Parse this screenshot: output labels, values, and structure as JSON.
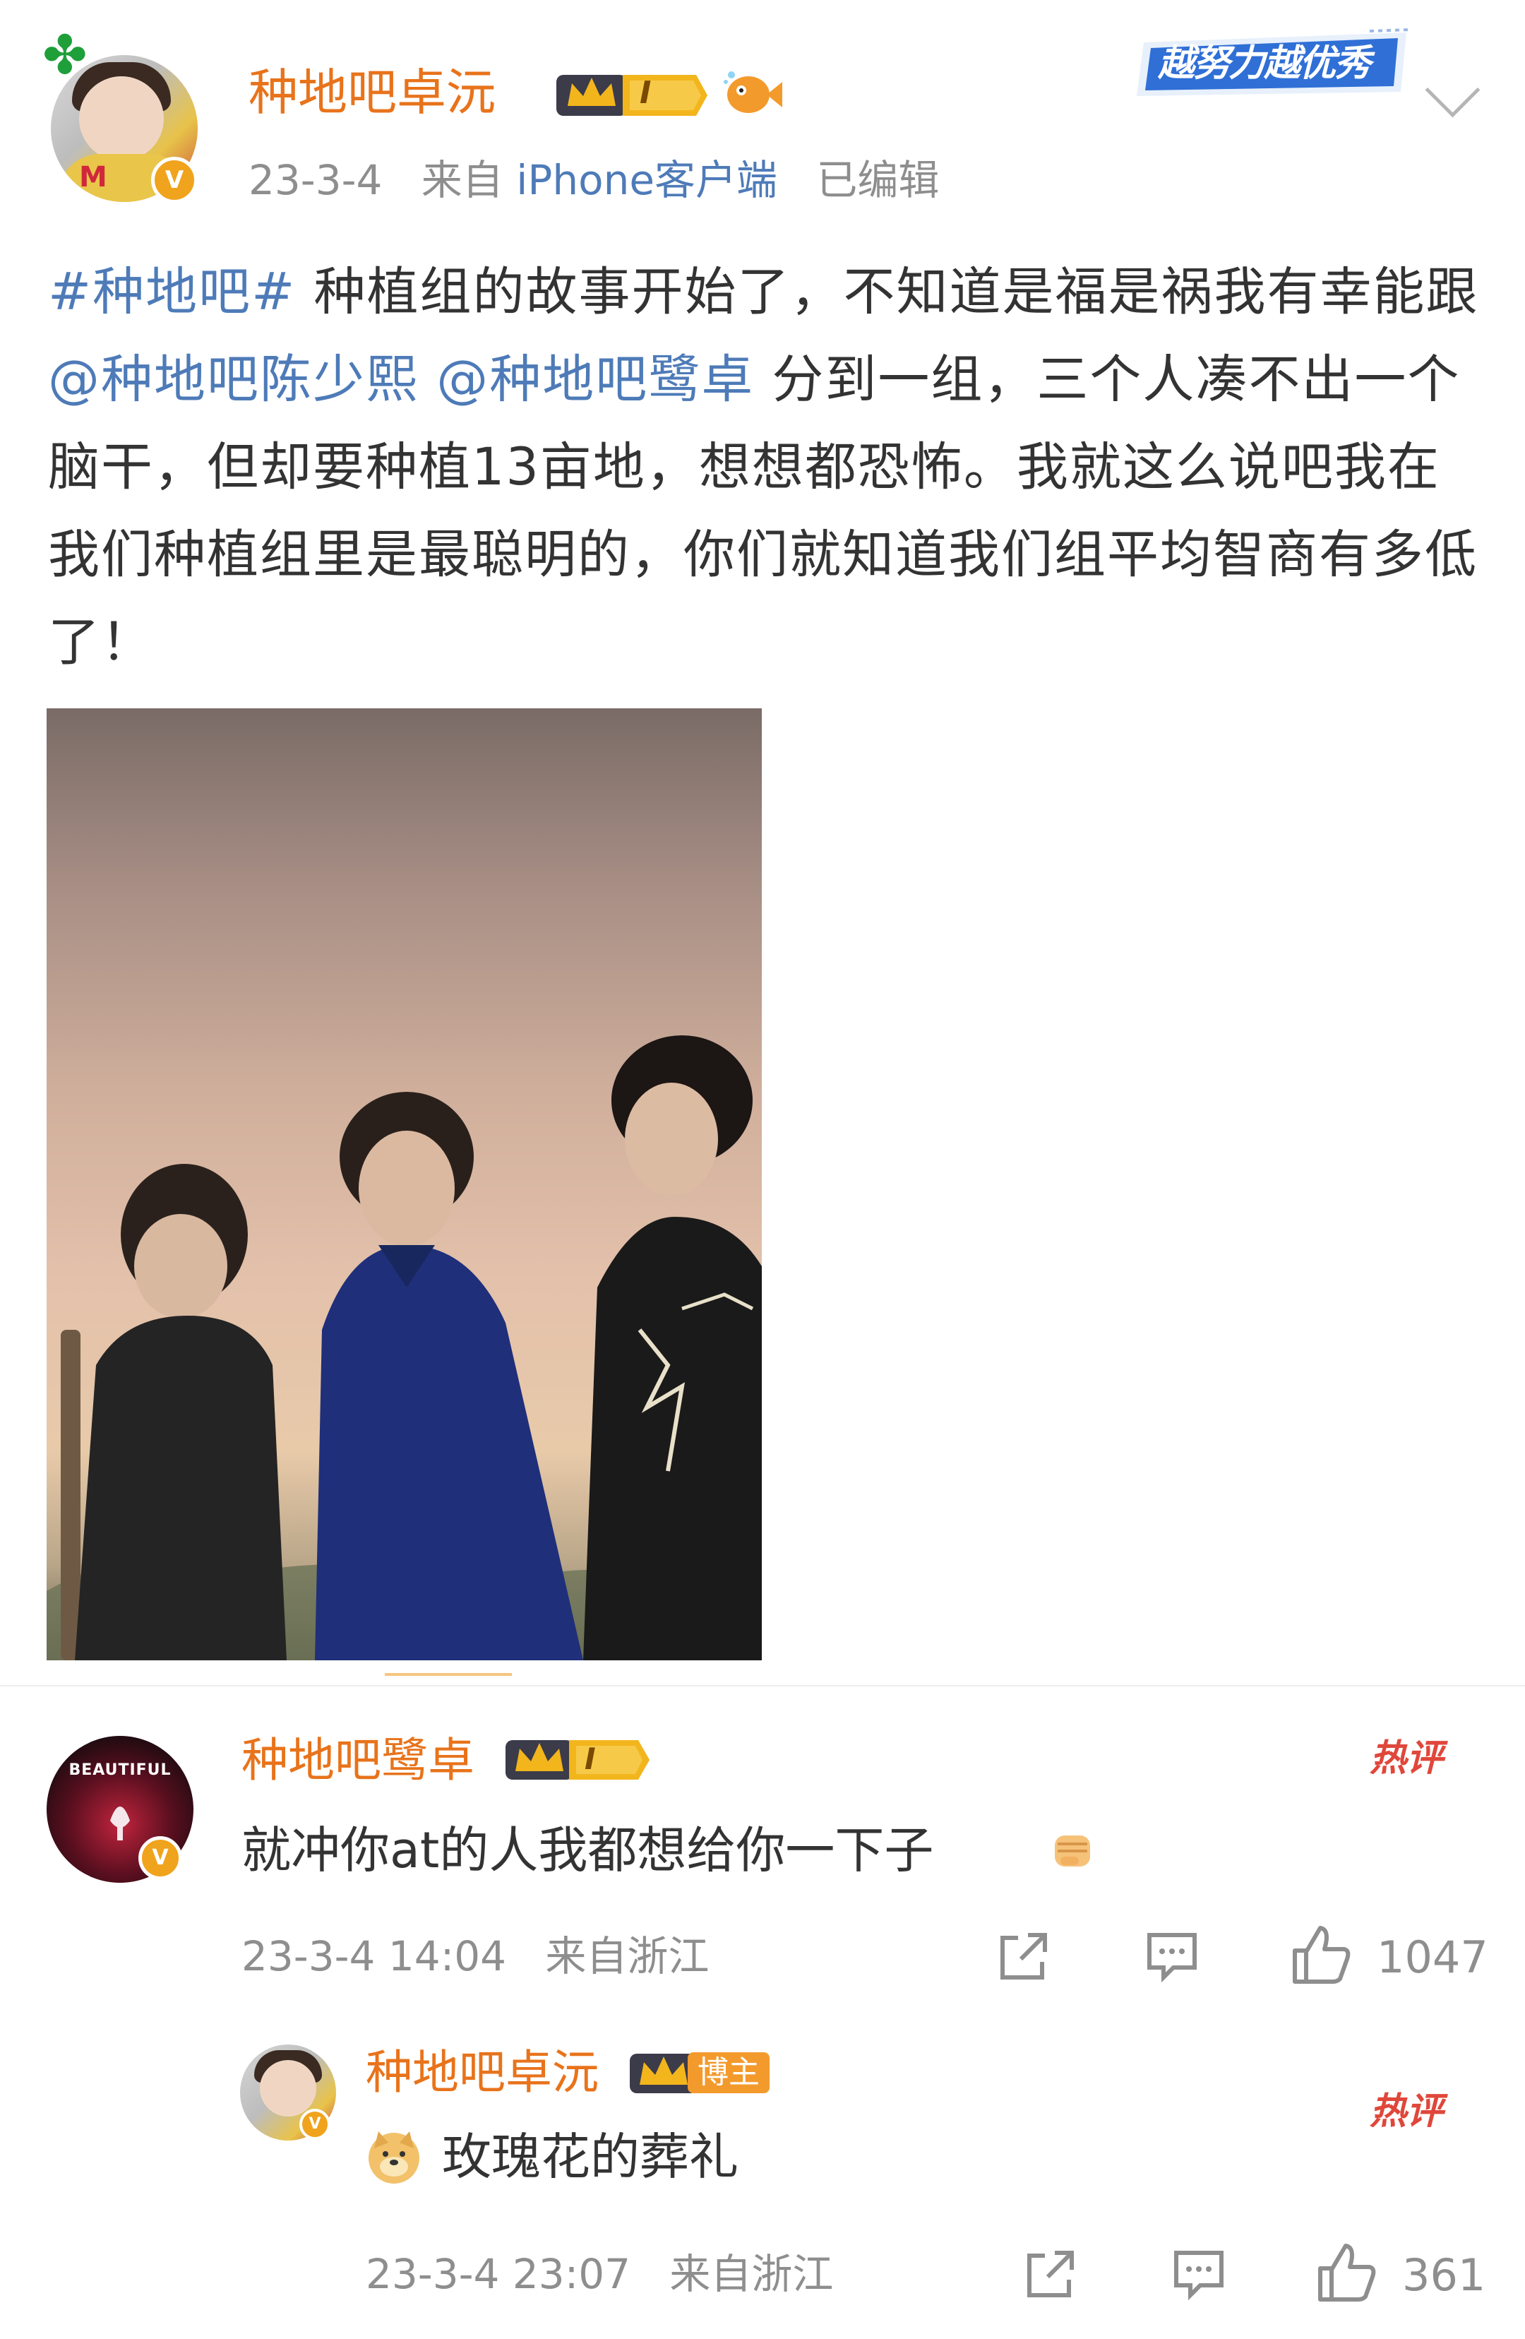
{
  "post": {
    "author": "种地吧卓沅",
    "rank_badge": "I",
    "date": "23-3-4",
    "from_prefix": "来自",
    "source": "iPhone客户端",
    "edited": "已编辑",
    "promo_badge": "越努力越优秀",
    "text_parts": {
      "topic": "#种地吧#",
      "t1": " 种植组的故事开始了，不知道是福是祸我有幸能跟",
      "mention1": "@种地吧陈少熙",
      "t2": " ",
      "mention2": "@种地吧鹭卓",
      "t3": " 分到一组，三个人凑不出一个脑干，但却要种植13亩地，想想都恐怖。我就这么说吧我在我们种植组里是最聪明的，你们就知道我们组平均智商有多低了！"
    }
  },
  "comments": [
    {
      "author": "种地吧鹭卓",
      "rank_badge": "I",
      "avatar_text": "BEAUTIFUL",
      "text": "就冲你at的人我都想给你一下子",
      "time": "23-3-4 14:04",
      "location": "来自浙江",
      "hot_label": "热评",
      "likes": "1047"
    },
    {
      "author": "种地吧卓沅",
      "host_tag": "博主",
      "text": "玫瑰花的葬礼",
      "time": "23-3-4 23:07",
      "location": "来自浙江",
      "hot_label": "热评",
      "likes": "361"
    }
  ],
  "icons": {
    "clover": "clover-icon",
    "verified": "verified-v-icon",
    "chevron": "chevron-down-icon",
    "repost": "share-icon",
    "comment": "comment-icon",
    "like": "thumbs-up-icon",
    "fist": "fist-emoji",
    "doge": "doge-emoji"
  },
  "colors": {
    "username": "#e8731b",
    "link": "#4e7bb8",
    "meta": "#8e8e8e",
    "hot": "#e0473b",
    "verified": "#f0a31c"
  }
}
